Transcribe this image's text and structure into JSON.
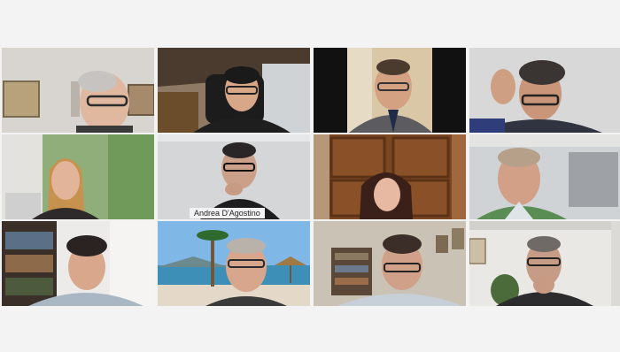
{
  "meeting": {
    "layout": "gallery-4x3",
    "active_speaker_tile": 6,
    "highlight_color": "#3aa7d8",
    "participants": [
      {
        "name": ""
      },
      {
        "name": ""
      },
      {
        "name": ""
      },
      {
        "name": ""
      },
      {
        "name": ""
      },
      {
        "name": "Andrea D'Agostino"
      },
      {
        "name": ""
      },
      {
        "name": ""
      },
      {
        "name": ""
      },
      {
        "name": ""
      },
      {
        "name": ""
      },
      {
        "name": ""
      }
    ]
  }
}
